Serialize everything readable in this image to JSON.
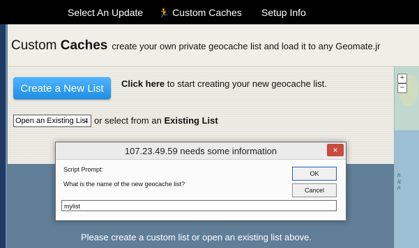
{
  "nav": {
    "items": [
      {
        "label": "Select An Update"
      },
      {
        "label": "Custom Caches",
        "icon": "runner-icon"
      },
      {
        "label": "Setup Info"
      }
    ]
  },
  "header": {
    "title_light": "Custom ",
    "title_bold": "Caches",
    "subtitle": "create your own private geocache list and load it to any Geomate.jr"
  },
  "actions": {
    "create_label": "Create a New List",
    "click_here": "Click here",
    "click_rest": " to start creating your new geocache list.",
    "select_value": "Open an Existing List",
    "or_text": " or select from an ",
    "existing_bold": "Existing List"
  },
  "status": {
    "message": "Please create a custom list or open an existing list above."
  },
  "dialog": {
    "title": "107.23.49.59 needs some information",
    "close_icon": "×",
    "label": "Script Prompt:",
    "question": "What is the name of the new geocache list?",
    "ok_label": "OK",
    "cancel_label": "Cancel",
    "input_value": "mylist"
  },
  "map": {
    "zoom_in": "+",
    "zoom_out": "−",
    "fragment": "h\nic\nn"
  },
  "colors": {
    "top_nav": "#000000",
    "primary_button": "#2f9ef2",
    "close_button": "#c84b3f",
    "lower_panel": "#607e97"
  }
}
